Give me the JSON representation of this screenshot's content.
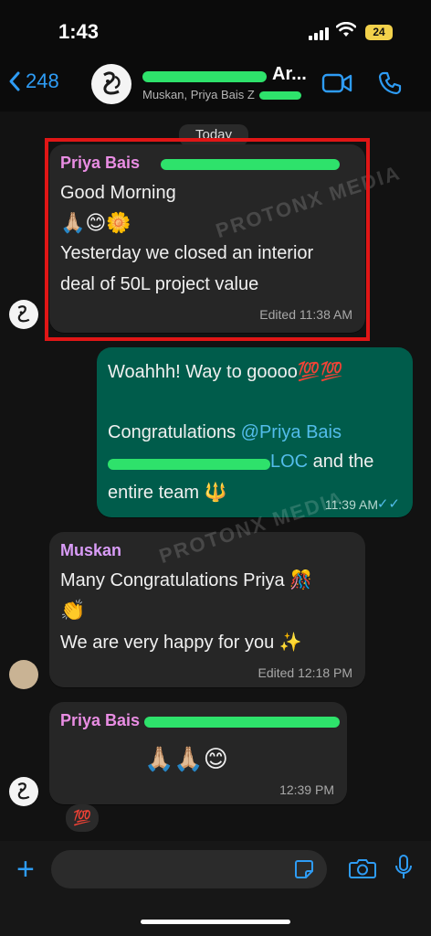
{
  "status_bar": {
    "time": "1:43",
    "battery": "24"
  },
  "header": {
    "back_count": "248",
    "group_title": "Ar...",
    "group_subtitle": "Muskan, Priya Bais Z"
  },
  "chat": {
    "date_label": "Today",
    "watermark": "PROTONX MEDIA",
    "messages": [
      {
        "sender": "Priya Bais",
        "lines": [
          "Good Morning",
          "🙏🏼😊🌼",
          "Yesterday we closed an interior",
          "deal of 50L project value"
        ],
        "time": "Edited  11:38 AM"
      },
      {
        "line1": "Woahhh! Way to goooo💯💯",
        "line2_prefix": "Congratulations ",
        "mention_a": "@Priya Bais",
        "mention_b": "LOC",
        "line3_suffix": " and the",
        "line4": "entire team 🔱",
        "time": "11:39 AM",
        "ticks": "✓✓"
      },
      {
        "sender": "Muskan",
        "lines": [
          "Many Congratulations Priya 🎊",
          "👏",
          "We are very happy for you ✨"
        ],
        "time": "Edited  12:18 PM"
      },
      {
        "sender": "Priya Bais",
        "lines": [
          "🙏🏼🙏🏼😊"
        ],
        "time": "12:39 PM"
      }
    ],
    "reaction": "💯"
  },
  "composer": {
    "placeholder": ""
  },
  "colors": {
    "accent": "#2e9cf5",
    "outgoing_bubble": "#005c4b",
    "incoming_bubble": "#262626",
    "sender_priya": "#e98de3",
    "sender_muskan": "#d99cf7",
    "highlight": "#e01616",
    "redaction": "#2ee26b"
  }
}
